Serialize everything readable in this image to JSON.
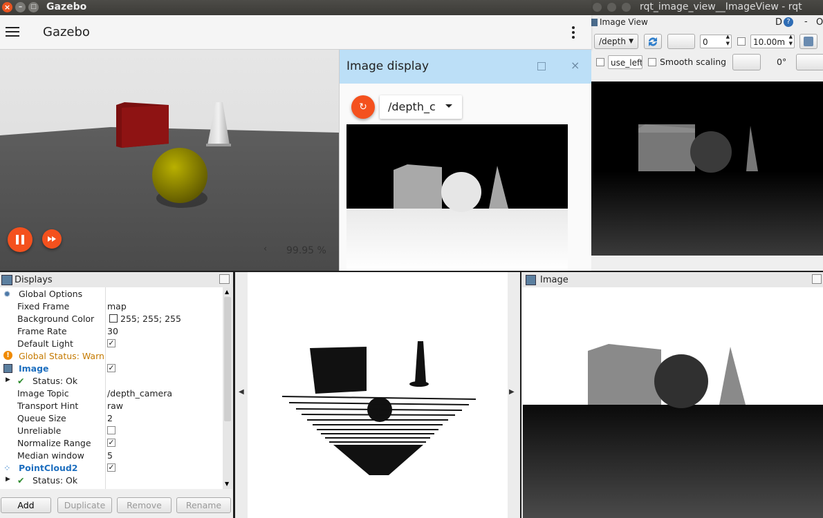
{
  "rqt": {
    "window_title": "rqt_image_view__ImageView - rqt",
    "panel_title": "Image View",
    "help_letter": "D",
    "topic": "/depth",
    "field_zero": "0",
    "max_range": "10.00m",
    "use_left": "use_left",
    "smooth_scaling_label": "Smooth scaling",
    "rotation": "0°",
    "edge_letter": "O"
  },
  "gazebo": {
    "window_title": "Gazebo",
    "app_title": "Gazebo",
    "real_time_factor": "99.95 %",
    "image_display": {
      "title": "Image display",
      "topic": "/depth_c"
    }
  },
  "rviz": {
    "displays_title": "Displays",
    "tree": [
      {
        "key": "Global Options",
        "indent": 0,
        "icon": "gear-icon"
      },
      {
        "key": "Fixed Frame",
        "value": "map",
        "indent": 1
      },
      {
        "key": "Background Color",
        "value": "255; 255; 255",
        "indent": 1,
        "swatch": "#ffffff"
      },
      {
        "key": "Frame Rate",
        "value": "30",
        "indent": 1
      },
      {
        "key": "Default Light",
        "checked": true,
        "indent": 1
      },
      {
        "key": "Global Status: Warn",
        "indent": 0,
        "icon": "warning-icon",
        "color": "#c57a00"
      },
      {
        "key": "Image",
        "checked": true,
        "indent": 0,
        "icon": "image-icon",
        "color": "#1e6fbf",
        "bold": true
      },
      {
        "key": "Status: Ok",
        "indent": 1,
        "icon": "checkmark-icon",
        "expandable": true
      },
      {
        "key": "Image Topic",
        "value": "/depth_camera",
        "indent": 1
      },
      {
        "key": "Transport Hint",
        "value": "raw",
        "indent": 1
      },
      {
        "key": "Queue Size",
        "value": "2",
        "indent": 1
      },
      {
        "key": "Unreliable",
        "checked": false,
        "indent": 1
      },
      {
        "key": "Normalize Range",
        "checked": true,
        "indent": 1
      },
      {
        "key": "Median window",
        "value": "5",
        "indent": 1
      },
      {
        "key": "PointCloud2",
        "checked": true,
        "indent": 0,
        "icon": "pointcloud-icon",
        "color": "#1e6fbf",
        "bold": true
      },
      {
        "key": "Status: Ok",
        "indent": 1,
        "icon": "checkmark-icon",
        "expandable": true
      }
    ],
    "buttons": {
      "add": "Add",
      "duplicate": "Duplicate",
      "remove": "Remove",
      "rename": "Rename"
    },
    "image_panel_title": "Image"
  }
}
